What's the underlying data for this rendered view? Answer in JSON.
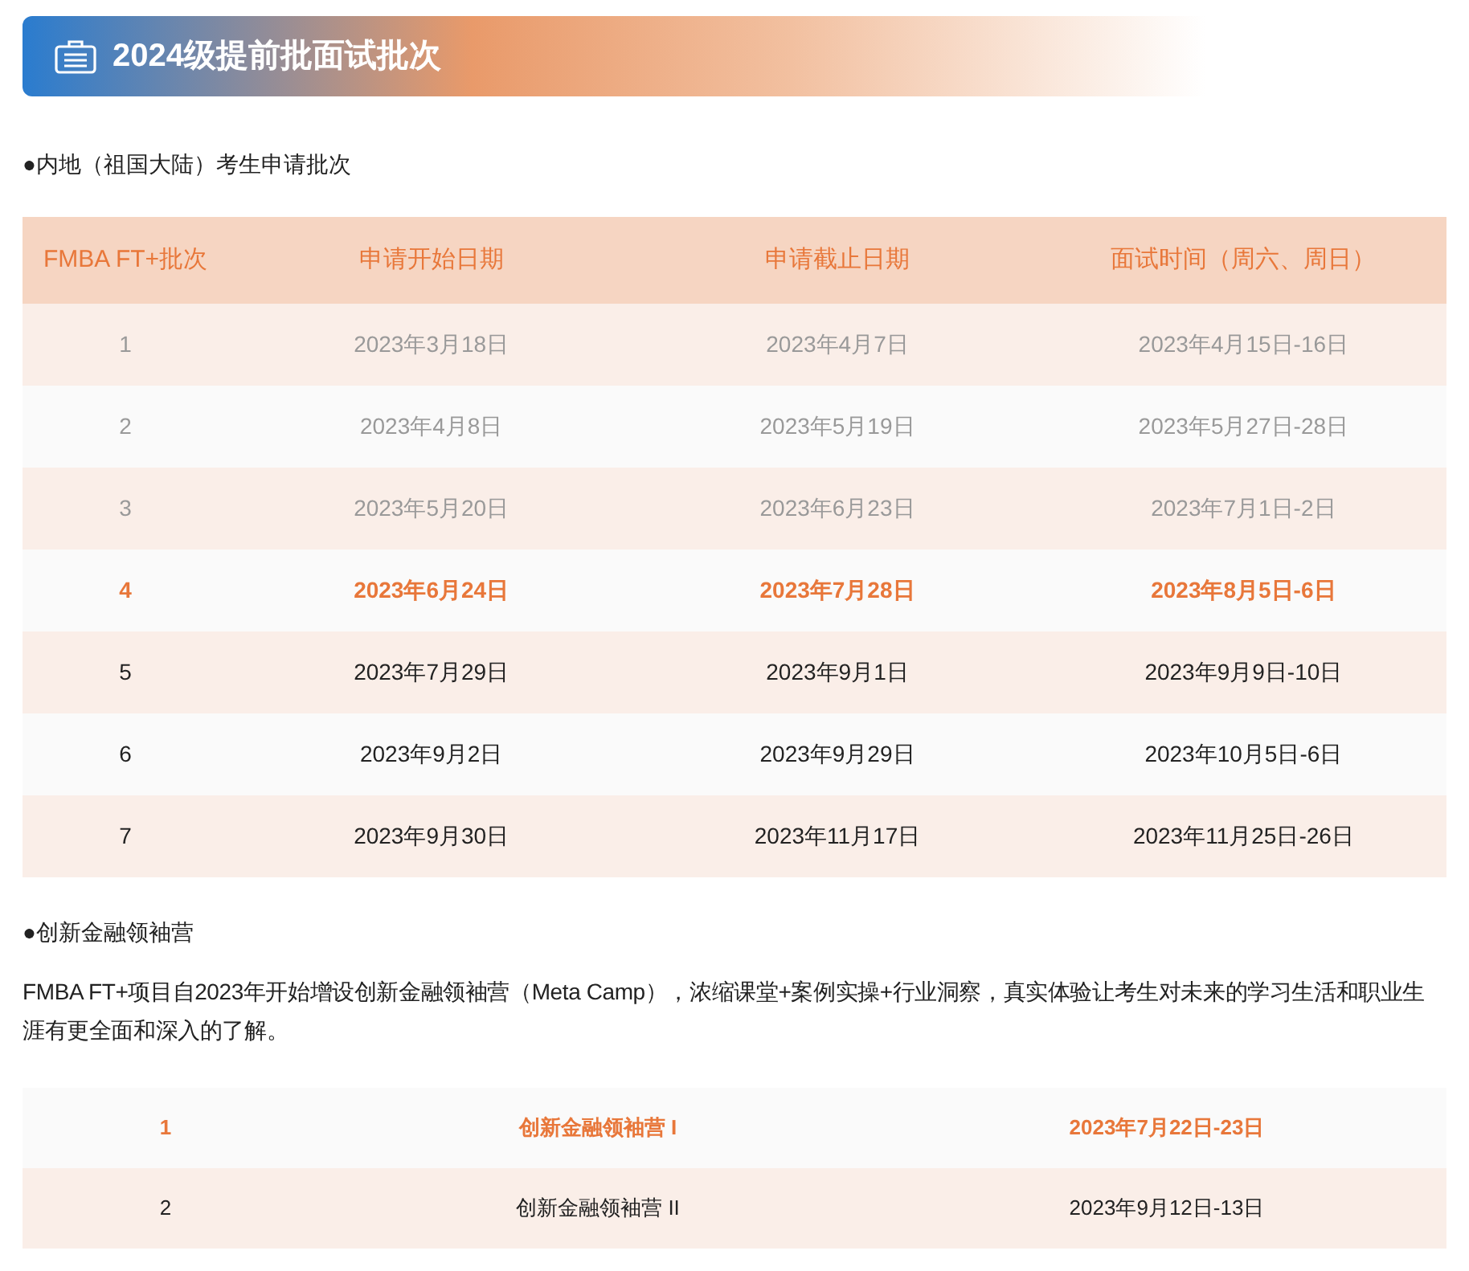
{
  "banner": {
    "title": "2024级提前批面试批次"
  },
  "section_1": {
    "heading": "●内地（祖国大陆）考生申请批次",
    "table": {
      "columns": [
        "FMBA FT+批次",
        "申请开始日期",
        "申请截止日期",
        "面试时间（周六、周日）"
      ],
      "rows": [
        {
          "kind": "past",
          "cells": [
            "1",
            "2023年3月18日",
            "2023年4月7日",
            "2023年4月15日-16日"
          ]
        },
        {
          "kind": "past",
          "cells": [
            "2",
            "2023年4月8日",
            "2023年5月19日",
            "2023年5月27日-28日"
          ]
        },
        {
          "kind": "past",
          "cells": [
            "3",
            "2023年5月20日",
            "2023年6月23日",
            "2023年7月1日-2日"
          ]
        },
        {
          "kind": "current",
          "cells": [
            "4",
            "2023年6月24日",
            "2023年7月28日",
            "2023年8月5日-6日"
          ]
        },
        {
          "kind": "upcoming",
          "cells": [
            "5",
            "2023年7月29日",
            "2023年9月1日",
            "2023年9月9日-10日"
          ]
        },
        {
          "kind": "upcoming",
          "cells": [
            "6",
            "2023年9月2日",
            "2023年9月29日",
            "2023年10月5日-6日"
          ]
        },
        {
          "kind": "upcoming",
          "cells": [
            "7",
            "2023年9月30日",
            "2023年11月17日",
            "2023年11月25日-26日"
          ]
        }
      ]
    }
  },
  "section_2": {
    "heading": "●创新金融领袖营",
    "paragraph": "FMBA FT+项目自2023年开始增设创新金融领袖营（Meta Camp），浓缩课堂+案例实操+行业洞察，真实体验让考生对未来的学习生活和职业生涯有更全面和深入的了解。",
    "table": {
      "rows": [
        {
          "kind": "current",
          "cells": [
            "1",
            "创新金融领袖营 I",
            "2023年7月22日-23日"
          ]
        },
        {
          "kind": "upcoming",
          "cells": [
            "2",
            "创新金融领袖营 II",
            "2023年9月12日-13日"
          ]
        }
      ]
    }
  }
}
